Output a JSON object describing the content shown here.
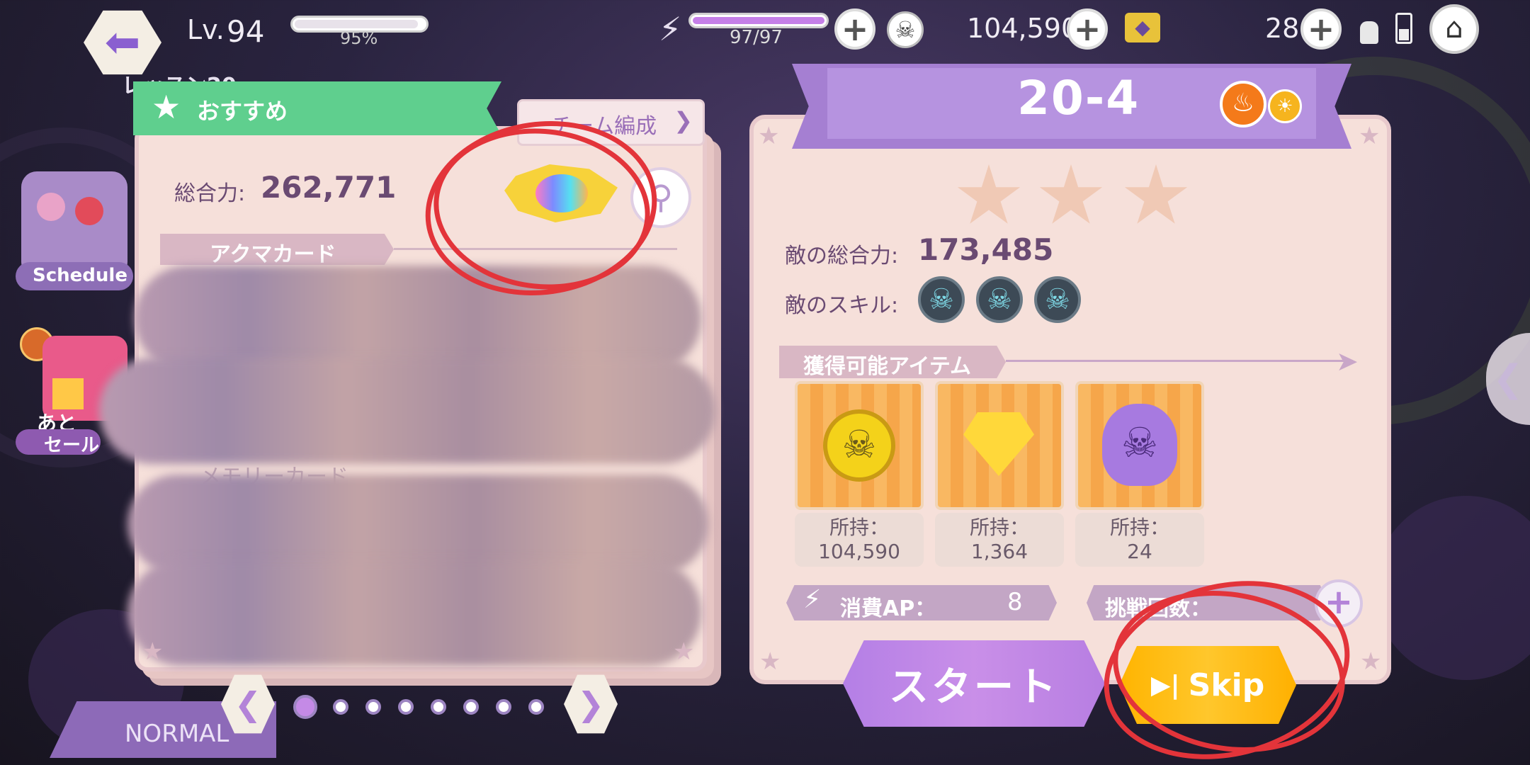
{
  "top_bar": {
    "level_label": "Lv.",
    "level_value": "94",
    "exp_percent_text": "95%",
    "exp_fraction": 0.95,
    "stamina_text": "97/97",
    "stamina_fraction": 1.0,
    "coins": "104,590",
    "gems": "28"
  },
  "left_side": {
    "lesson_label": "レッスン20",
    "schedule_label": "Schedule",
    "sale_label": "セール",
    "sale_prefix": "あと",
    "mode_label": "NORMAL"
  },
  "left_panel": {
    "recommend_label": "おすすめ",
    "team_formation_label": "チーム編成",
    "total_power_label": "総合力:",
    "total_power_value": "262,771",
    "akuma_card_label": "アクマカード",
    "memory_card_label": "メモリーカード",
    "page_dots": 8,
    "active_page": 0
  },
  "stage": {
    "title": "20-4",
    "stars_earned": 0,
    "stars_total": 3,
    "enemy_power_label": "敵の総合力:",
    "enemy_power_value": "173,485",
    "enemy_skill_label": "敵のスキル:",
    "obtainable_items_label": "獲得可能アイテム",
    "items": [
      {
        "icon": "skull-coin-icon",
        "owned_label": "所持：",
        "owned_value": "104,590"
      },
      {
        "icon": "yellow-gem-icon",
        "owned_label": "所持：",
        "owned_value": "1,364"
      },
      {
        "icon": "purple-skull-icon",
        "owned_label": "所持：",
        "owned_value": "24"
      }
    ],
    "ap_cost_label": "消費AP：",
    "ap_cost_value": "8",
    "attempts_label": "挑戦回数：",
    "start_label": "スタート",
    "skip_label": "Skip"
  },
  "colors": {
    "accent_purple": "#a57fd2",
    "recommend_green": "#5fcf8e",
    "skip_yellow": "#ffc72c",
    "annotation_red": "#e3343a",
    "panel_bg": "#f6e0da"
  }
}
